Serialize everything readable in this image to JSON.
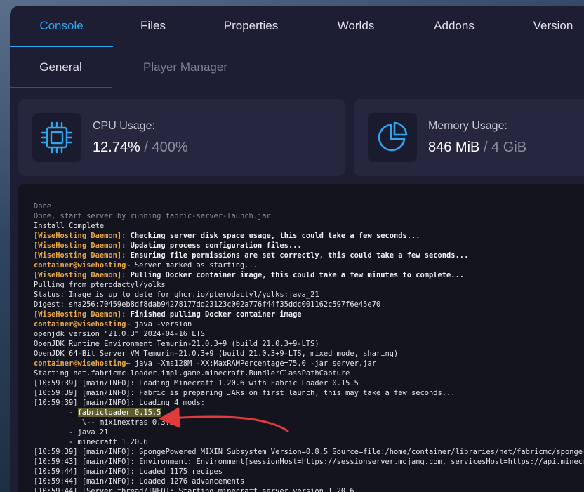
{
  "tabs": [
    {
      "label": "Console",
      "active": true
    },
    {
      "label": "Files",
      "active": false
    },
    {
      "label": "Properties",
      "active": false
    },
    {
      "label": "Worlds",
      "active": false
    },
    {
      "label": "Addons",
      "active": false
    },
    {
      "label": "Version",
      "active": false
    }
  ],
  "subtabs": [
    {
      "label": "General",
      "active": true
    },
    {
      "label": "Player Manager",
      "active": false
    }
  ],
  "cpu": {
    "label": "CPU Usage:",
    "value": "12.74%",
    "separator": "/",
    "limit": "400%",
    "icon": "cpu-chip-icon"
  },
  "memory": {
    "label": "Memory Usage:",
    "value": "846 MiB",
    "separator": "/",
    "limit": "4 GiB",
    "icon": "pie-chart-icon"
  },
  "colors": {
    "accent": "#2fa6ee",
    "daemon": "#e7a648",
    "panel": "#1d1d33",
    "console_bg": "#14141f",
    "arrow": "#e03a3a"
  },
  "console": {
    "lines": [
      {
        "text": "Done",
        "kind": "dim"
      },
      {
        "text": "Done, start server by running fabric-server-launch.jar",
        "kind": "dim"
      },
      {
        "text": "Install Complete",
        "kind": "plain"
      },
      {
        "prefix": "[WiseHosting Daemon]:",
        "text": " Checking server disk space usage, this could take a few seconds...",
        "kind": "daemon"
      },
      {
        "prefix": "[WiseHosting Daemon]:",
        "text": " Updating process configuration files...",
        "kind": "daemon"
      },
      {
        "prefix": "[WiseHosting Daemon]:",
        "text": " Ensuring file permissions are set correctly, this could take a few seconds...",
        "kind": "daemon"
      },
      {
        "prefix": "container@wisehosting~",
        "text": " Server marked as starting...",
        "kind": "prompt"
      },
      {
        "prefix": "[WiseHosting Daemon]:",
        "text": " Pulling Docker container image, this could take a few minutes to complete...",
        "kind": "daemon"
      },
      {
        "text": "Pulling from pterodactyl/yolks",
        "kind": "plain"
      },
      {
        "text": "Status: Image is up to date for ghcr.io/pterodactyl/yolks:java_21",
        "kind": "plain"
      },
      {
        "text": "Digest: sha256:70459eb8df8dab94278177dd23123c002a776f44f35ddc001162c597f6e45e70",
        "kind": "plain"
      },
      {
        "prefix": "[WiseHosting Daemon]:",
        "text": " Finished pulling Docker container image",
        "kind": "daemon"
      },
      {
        "prefix": "container@wisehosting~",
        "text": " java -version",
        "kind": "prompt"
      },
      {
        "text": "openjdk version \"21.0.3\" 2024-04-16 LTS",
        "kind": "plain"
      },
      {
        "text": "OpenJDK Runtime Environment Temurin-21.0.3+9 (build 21.0.3+9-LTS)",
        "kind": "plain"
      },
      {
        "text": "OpenJDK 64-Bit Server VM Temurin-21.0.3+9 (build 21.0.3+9-LTS, mixed mode, sharing)",
        "kind": "plain"
      },
      {
        "prefix": "container@wisehosting~",
        "text": " java -Xms128M -XX:MaxRAMPercentage=75.0 -jar server.jar",
        "kind": "prompt"
      },
      {
        "text": "Starting net.fabricmc.loader.impl.game.minecraft.BundlerClassPathCapture",
        "kind": "plain"
      },
      {
        "text": "[10:59:39] [main/INFO]: Loading Minecraft 1.20.6 with Fabric Loader 0.15.5",
        "kind": "plain"
      },
      {
        "text": "[10:59:39] [main/INFO]: Fabric is preparing JARs on first launch, this may take a few seconds...",
        "kind": "plain"
      },
      {
        "text": "[10:59:39] [main/INFO]: Loading 4 mods:",
        "kind": "plain"
      },
      {
        "prefix": "        - ",
        "text": "fabricloader 0.15.5",
        "kind": "highlight"
      },
      {
        "text": "           \\-- mixinextras 0.3.2",
        "kind": "plain"
      },
      {
        "text": "        - java 21",
        "kind": "plain"
      },
      {
        "text": "        - minecraft 1.20.6",
        "kind": "plain"
      },
      {
        "text": "[10:59:39] [main/INFO]: SpongePowered MIXIN Subsystem Version=0.8.5 Source=file:/home/container/libraries/net/fabricmc/sponge-mixin",
        "kind": "plain"
      },
      {
        "text": "[10:59:43] [main/INFO]: Environment: Environment[sessionHost=https://sessionserver.mojang.com, servicesHost=https://api.minecraftse",
        "kind": "plain"
      },
      {
        "text": "[10:59:44] [main/INFO]: Loaded 1175 recipes",
        "kind": "plain"
      },
      {
        "text": "[10:59:44] [main/INFO]: Loaded 1276 advancements",
        "kind": "plain"
      },
      {
        "text": "[10:59:44] [Server thread/INFO]: Starting minecraft server version 1.20.6",
        "kind": "plain"
      }
    ]
  }
}
